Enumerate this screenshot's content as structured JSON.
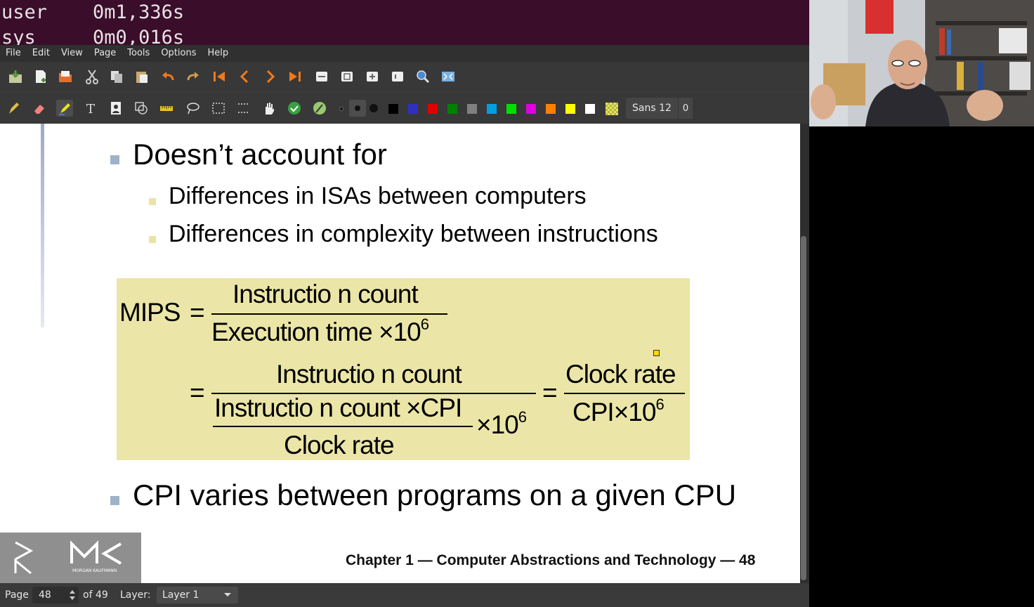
{
  "terminal": {
    "line1": "user    0m1,336s",
    "line2": "sys     0m0,016s"
  },
  "menu": [
    "File",
    "Edit",
    "View",
    "Page",
    "Tools",
    "Options",
    "Help"
  ],
  "toolbar": {
    "font_label": "Sans 12",
    "thickness_label": "0"
  },
  "palette": [
    "#000000",
    "#3030c0",
    "#e00000",
    "#008000",
    "#808080",
    "#00a0e0",
    "#00e000",
    "#e000e0",
    "#ff8000",
    "#ffff00",
    "#ffffff"
  ],
  "slide": {
    "bullet1": "Doesn’t account for",
    "sub1": "Differences in ISAs between computers",
    "sub2": "Differences in complexity between instructions",
    "bullet2": "CPI varies between programs on a given CPU",
    "formula": {
      "mips": "MIPS",
      "eq": "=",
      "num1": "Instructio n count",
      "den1": "Execution  time",
      "times": "×",
      "ten": "10",
      "exp": "6",
      "num2": "Instructio n count",
      "den2_top": "Instructio n count",
      "cpi": "CPI",
      "clock_rate": "Clock rate",
      "num3": "Clock rate",
      "den3": "CPI"
    },
    "footer": "Chapter 1 — Computer Abstractions and Technology — 48",
    "logo_text": "MORGAN KAUFMANN"
  },
  "status": {
    "page_label": "Page",
    "page_value": "48",
    "of_label": "of 49",
    "layer_label": "Layer:",
    "layer_value": "Layer 1"
  }
}
